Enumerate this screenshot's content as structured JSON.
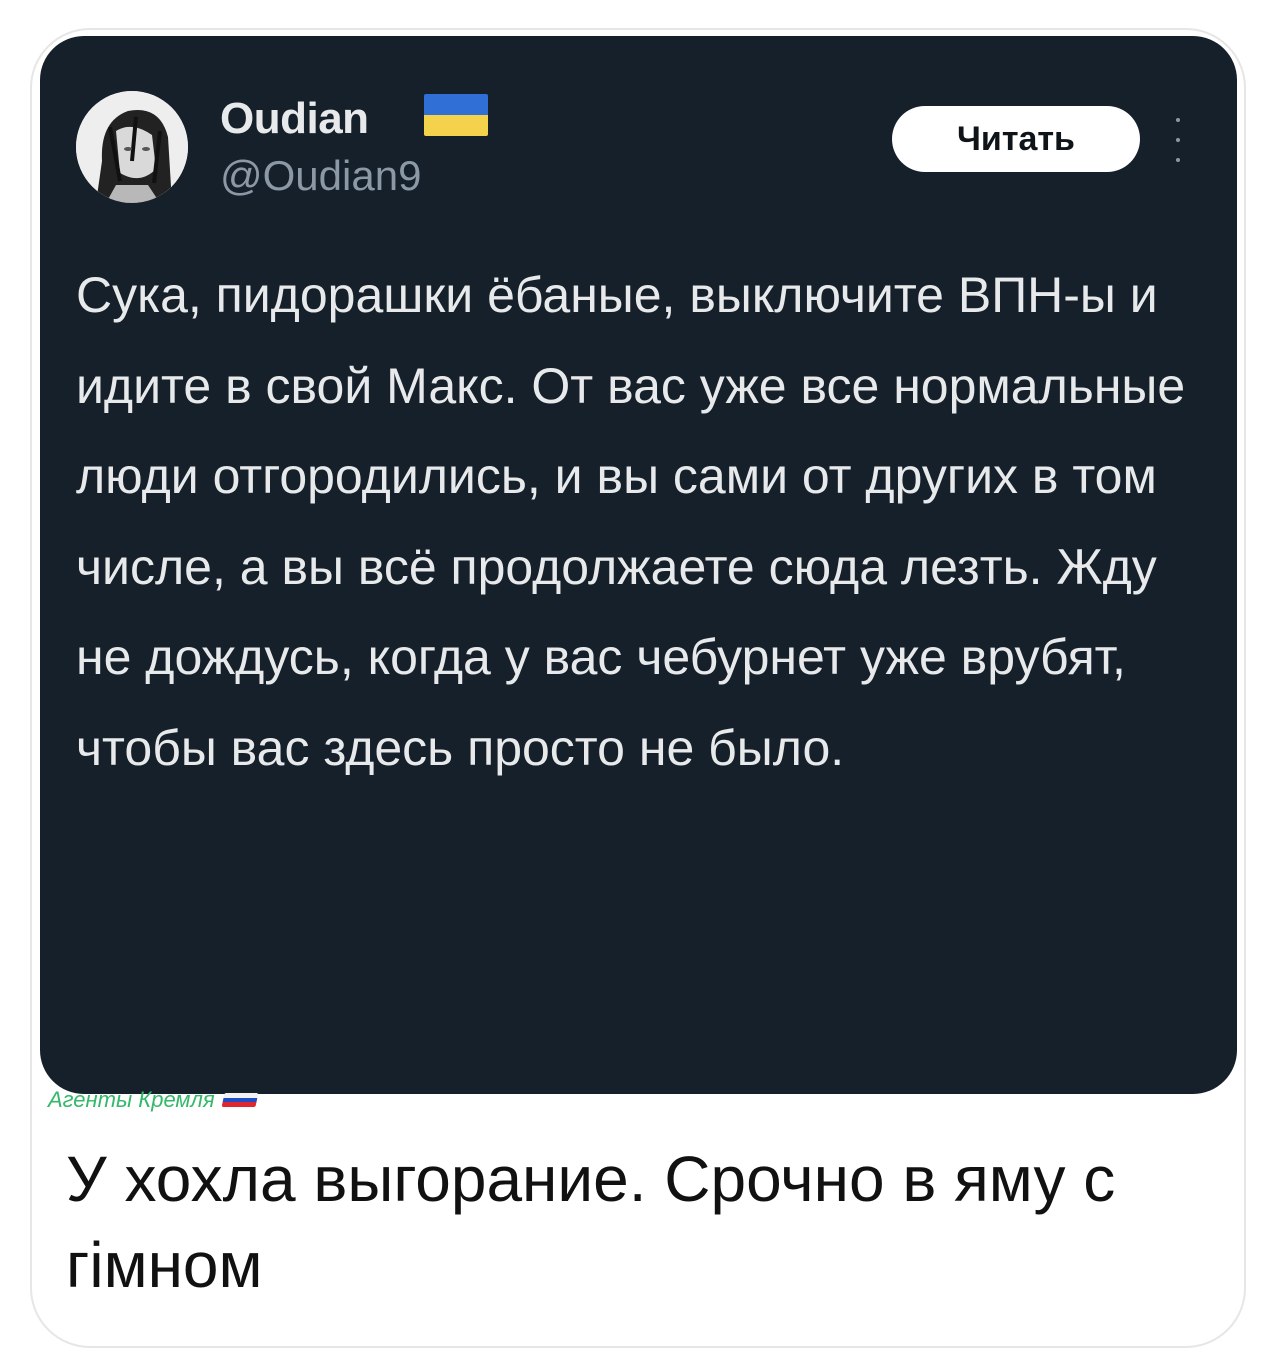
{
  "tweet": {
    "display_name": "Oudian",
    "handle": "@Oudian9",
    "follow_label": "Читать",
    "avatar_icon": "anime-character-avatar",
    "flag_icon": "ukraine-flag-emoji",
    "text": "Сука, пидорашки ёбаные, выключите ВПН-ы и идите в свой Макс. От вас уже все нормальные люди отгородились, и вы сами от других в том числе, а вы всё продолжаете сюда лезть. Жду не дождусь, когда у вас чебурнет уже врубят, чтобы вас здесь просто не было."
  },
  "watermark": {
    "text": "Агенты Кремля",
    "flag_icon": "russia-flag-emoji"
  },
  "post": {
    "caption": "У хохла выгорание. Срочно в яму с гімном"
  },
  "colors": {
    "tweet_bg": "#15202b",
    "text_primary": "#e7e9ea",
    "text_secondary": "#8b98a5",
    "watermark": "#34b869"
  }
}
